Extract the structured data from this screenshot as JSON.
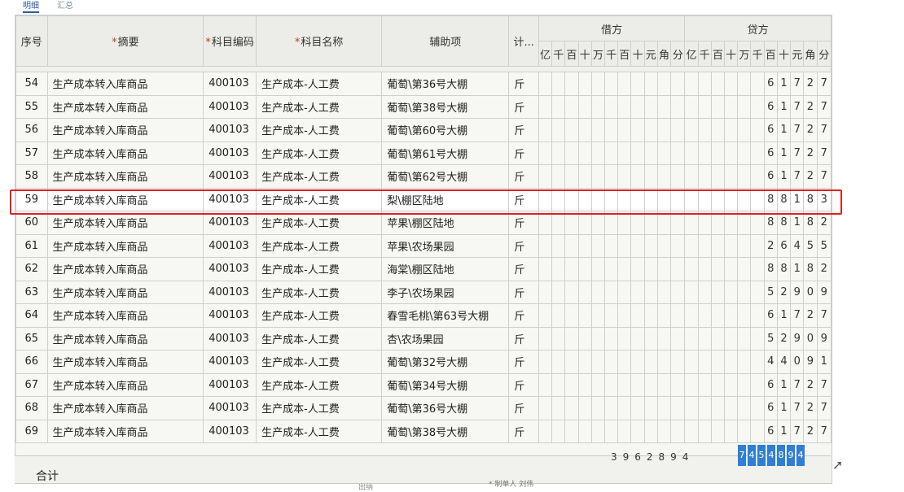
{
  "tabs": [
    {
      "label": "明细"
    },
    {
      "label": "汇总"
    }
  ],
  "header": {
    "seq": "序号",
    "summary": "摘要",
    "account_code": "科目编码",
    "account_name": "科目名称",
    "auxiliary": "辅助项",
    "unit": "计...",
    "debit": "借方",
    "credit": "贷方",
    "digit_units": [
      "亿",
      "千",
      "百",
      "十",
      "万",
      "千",
      "百",
      "十",
      "元",
      "角",
      "分"
    ]
  },
  "rows": [
    {
      "seq": "54",
      "summary": "生产成本转入库商品",
      "code": "400103",
      "name": "生产成本-人工费",
      "aux": "葡萄\\第36号大棚",
      "unit": "斤",
      "credit": "61727"
    },
    {
      "seq": "55",
      "summary": "生产成本转入库商品",
      "code": "400103",
      "name": "生产成本-人工费",
      "aux": "葡萄\\第38号大棚",
      "unit": "斤",
      "credit": "61727"
    },
    {
      "seq": "56",
      "summary": "生产成本转入库商品",
      "code": "400103",
      "name": "生产成本-人工费",
      "aux": "葡萄\\第60号大棚",
      "unit": "斤",
      "credit": "61727"
    },
    {
      "seq": "57",
      "summary": "生产成本转入库商品",
      "code": "400103",
      "name": "生产成本-人工费",
      "aux": "葡萄\\第61号大棚",
      "unit": "斤",
      "credit": "61727"
    },
    {
      "seq": "58",
      "summary": "生产成本转入库商品",
      "code": "400103",
      "name": "生产成本-人工费",
      "aux": "葡萄\\第62号大棚",
      "unit": "斤",
      "credit": "61727"
    },
    {
      "seq": "59",
      "summary": "生产成本转入库商品",
      "code": "400103",
      "name": "生产成本-人工费",
      "aux": "梨\\棚区陆地",
      "unit": "斤",
      "credit": "88183"
    },
    {
      "seq": "60",
      "summary": "生产成本转入库商品",
      "code": "400103",
      "name": "生产成本-人工费",
      "aux": "苹果\\棚区陆地",
      "unit": "斤",
      "credit": "88182"
    },
    {
      "seq": "61",
      "summary": "生产成本转入库商品",
      "code": "400103",
      "name": "生产成本-人工费",
      "aux": "苹果\\农场果园",
      "unit": "斤",
      "credit": "26455"
    },
    {
      "seq": "62",
      "summary": "生产成本转入库商品",
      "code": "400103",
      "name": "生产成本-人工费",
      "aux": "海棠\\棚区陆地",
      "unit": "斤",
      "credit": "88182"
    },
    {
      "seq": "63",
      "summary": "生产成本转入库商品",
      "code": "400103",
      "name": "生产成本-人工费",
      "aux": "李子\\农场果园",
      "unit": "斤",
      "credit": "52909"
    },
    {
      "seq": "64",
      "summary": "生产成本转入库商品",
      "code": "400103",
      "name": "生产成本-人工费",
      "aux": "春雪毛桃\\第63号大棚",
      "unit": "斤",
      "credit": "61727"
    },
    {
      "seq": "65",
      "summary": "生产成本转入库商品",
      "code": "400103",
      "name": "生产成本-人工费",
      "aux": "杏\\农场果园",
      "unit": "斤",
      "credit": "52909"
    },
    {
      "seq": "66",
      "summary": "生产成本转入库商品",
      "code": "400103",
      "name": "生产成本-人工费",
      "aux": "葡萄\\第32号大棚",
      "unit": "斤",
      "credit": "44091"
    },
    {
      "seq": "67",
      "summary": "生产成本转入库商品",
      "code": "400103",
      "name": "生产成本-人工费",
      "aux": "葡萄\\第34号大棚",
      "unit": "斤",
      "credit": "61727"
    },
    {
      "seq": "68",
      "summary": "生产成本转入库商品",
      "code": "400103",
      "name": "生产成本-人工费",
      "aux": "葡萄\\第36号大棚",
      "unit": "斤",
      "credit": "61727"
    },
    {
      "seq": "69",
      "summary": "生产成本转入库商品",
      "code": "400103",
      "name": "生产成本-人工费",
      "aux": "葡萄\\第38号大棚",
      "unit": "斤",
      "credit": "61727"
    }
  ],
  "selected_row_seq": "59",
  "footer": {
    "total_label": "合计",
    "debit_total": "3962894",
    "credit_total": "7454894",
    "preparer_label": "* 制单人",
    "preparer_name": "刘伟",
    "note": "出纳"
  },
  "colors": {
    "highlight": "#e02020",
    "active_tab": "#2c5aa0",
    "selected_total": "#2f7fd6"
  }
}
